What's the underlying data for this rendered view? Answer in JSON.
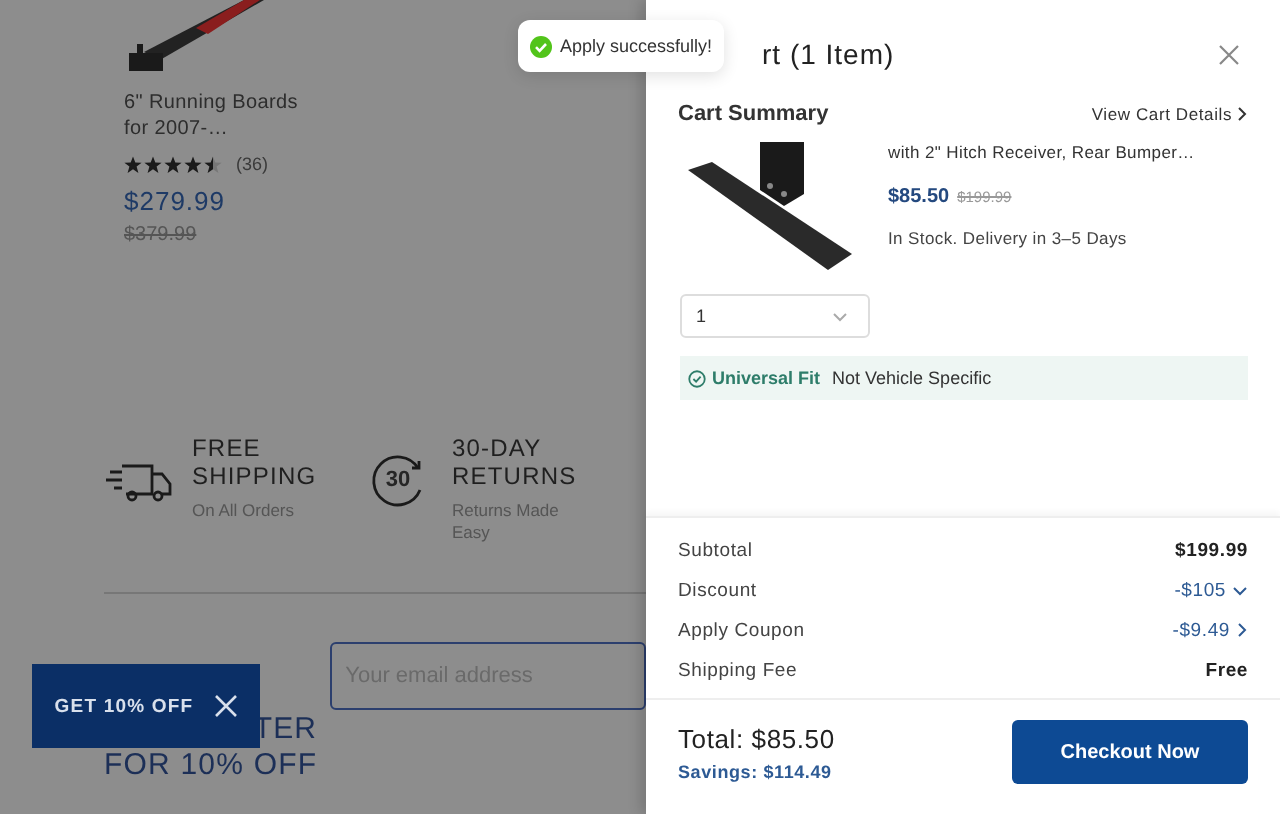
{
  "toast": {
    "text": "Apply successfully!"
  },
  "product": {
    "title": "6\" Running Boards for 2007-…",
    "stars": 4.5,
    "reviews": "(36)",
    "price": "$279.99",
    "old_price": "$379.99"
  },
  "features": [
    {
      "kind": "shipping",
      "title": "FREE SHIPPING",
      "subtitle": "On All Orders"
    },
    {
      "kind": "returns",
      "icon_text": "30",
      "title": "30-DAY RETURNS",
      "subtitle": "Returns Made Easy"
    }
  ],
  "newsletter": {
    "heading_line_1": "TER",
    "heading_line_2": "FOR 10% OFF",
    "placeholder": "Your email address"
  },
  "promo_button": {
    "label": "GET 10% OFF"
  },
  "cart": {
    "title": "rt (1 Item)",
    "summary_title": "Cart Summary",
    "details_link": "View Cart Details",
    "item": {
      "name": "with 2\" Hitch Receiver, Rear Bumper…",
      "price": "$85.50",
      "old_price": "$199.99",
      "stock": "In Stock. Delivery in 3–5 Days",
      "quantity": "1",
      "fit_label": "Universal Fit",
      "fit_note": "Not Vehicle Specific"
    },
    "summary": [
      {
        "kind": "plain",
        "label": "Subtotal",
        "value": "$199.99"
      },
      {
        "kind": "dropdown",
        "label": "Discount",
        "value": "-$105"
      },
      {
        "kind": "link",
        "label": "Apply Coupon",
        "value": "-$9.49"
      },
      {
        "kind": "plain",
        "label": "Shipping Fee",
        "value": "Free"
      }
    ],
    "total": "Total: $85.50",
    "savings": "Savings: $114.49",
    "checkout": "Checkout Now"
  }
}
